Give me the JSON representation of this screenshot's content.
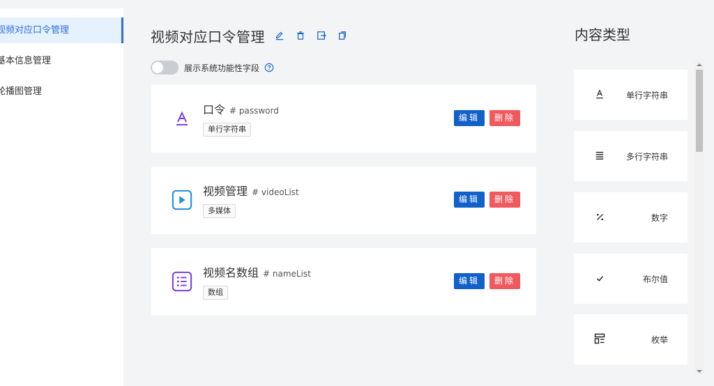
{
  "sidebar": {
    "items": [
      {
        "label": "视频对应口令管理",
        "active": true
      },
      {
        "label": "基本信息管理",
        "active": false
      },
      {
        "label": "轮播图管理",
        "active": false
      }
    ]
  },
  "header": {
    "title": "视频对应口令管理",
    "icons": [
      "edit-icon",
      "trash-icon",
      "export-icon",
      "copy-icon"
    ]
  },
  "toggle": {
    "label": "展示系统功能性字段",
    "on": false
  },
  "fields": [
    {
      "name": "口令",
      "key": "# password",
      "tag": "单行字符串",
      "icon": "text-a-icon"
    },
    {
      "name": "视频管理",
      "key": "# videoList",
      "tag": "多媒体",
      "icon": "media-play-icon"
    },
    {
      "name": "视频名数组",
      "key": "# nameList",
      "tag": "数组",
      "icon": "list-icon"
    }
  ],
  "actions": {
    "edit": "编辑",
    "delete": "删除"
  },
  "content_types": {
    "title": "内容类型",
    "items": [
      {
        "label": "单行字符串",
        "icon": "text-a-icon",
        "glyph": "A"
      },
      {
        "label": "多行字符串",
        "icon": "lines-icon",
        "glyph": "≡"
      },
      {
        "label": "数字",
        "icon": "percent-icon",
        "glyph": "%"
      },
      {
        "label": "布尔值",
        "icon": "check-icon",
        "glyph": "✓"
      },
      {
        "label": "枚举",
        "icon": "enum-icon",
        "glyph": "☷"
      }
    ]
  },
  "colors": {
    "accent": "#1261c9",
    "danger": "#f05a5f",
    "purple": "#7b3fe4",
    "blue": "#1e90d6"
  }
}
